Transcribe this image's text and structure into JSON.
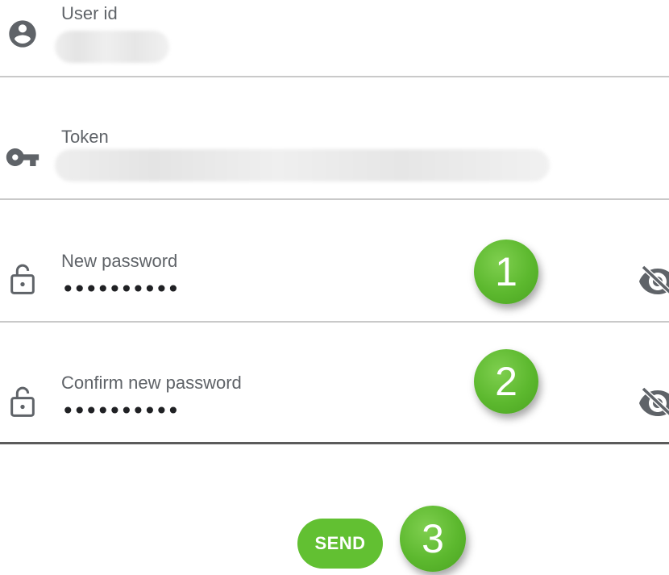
{
  "form": {
    "user_id": {
      "label": "User id",
      "icon": "account-circle-icon"
    },
    "token": {
      "label": "Token",
      "icon": "key-icon"
    },
    "new_password": {
      "label": "New password",
      "value": "••••••••••",
      "icon": "lock-open-icon",
      "toggle_icon": "visibility-off-icon"
    },
    "confirm_password": {
      "label": "Confirm new password",
      "value": "••••••••••",
      "icon": "lock-open-icon",
      "toggle_icon": "visibility-off-icon"
    },
    "send_label": "SEND"
  },
  "annotations": {
    "step1": "1",
    "step2": "2",
    "step3": "3",
    "color": "#5cb82e"
  },
  "colors": {
    "icon": "#5f6368",
    "label": "#5f6368",
    "underline": "#c9c9c9",
    "underline_active": "#5b5b5b",
    "accent": "#62c032"
  }
}
